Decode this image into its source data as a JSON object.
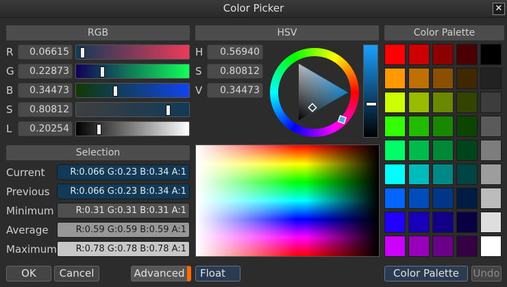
{
  "window": {
    "title": "Color Picker",
    "close_glyph": "✕"
  },
  "rgb": {
    "header": "RGB",
    "rows": [
      {
        "label": "R",
        "value": "0.06615",
        "fraction": 0.06615
      },
      {
        "label": "G",
        "value": "0.22873",
        "fraction": 0.22873
      },
      {
        "label": "B",
        "value": "0.34473",
        "fraction": 0.34473
      },
      {
        "label": "S",
        "value": "0.80812",
        "fraction": 0.80812
      },
      {
        "label": "L",
        "value": "0.20254",
        "fraction": 0.20254
      }
    ]
  },
  "hsv": {
    "header": "HSV",
    "rows": [
      {
        "label": "H",
        "value": "0.56940"
      },
      {
        "label": "S",
        "value": "0.80812"
      },
      {
        "label": "V",
        "value": "0.34473"
      }
    ]
  },
  "selection": {
    "header": "Selection",
    "rows": [
      {
        "label": "Current",
        "value": "R:0.066 G:0.23 B:0.34 A:1",
        "color": "#113a58",
        "text_color": "#e6e6e6"
      },
      {
        "label": "Previous",
        "value": "R:0.066 G:0.23 B:0.34 A:1",
        "color": "#113a58",
        "text_color": "#e6e6e6"
      },
      {
        "label": "Minimum",
        "value": "R:0.31 G:0.31 B:0.31 A:1",
        "color": "#4f4f4f",
        "text_color": "#e6e6e6"
      },
      {
        "label": "Average",
        "value": "R:0.59 G:0.59 B:0.59 A:1",
        "color": "#979797",
        "text_color": "#1a1a1a"
      },
      {
        "label": "Maximum",
        "value": "R:0.78 G:0.78 B:0.78 A:1",
        "color": "#c7c7c7",
        "text_color": "#1a1a1a"
      }
    ]
  },
  "palette": {
    "header": "Color Palette",
    "rows": [
      [
        "#ff0000",
        "#cc0000",
        "#8c0000",
        "#4a0000",
        "#000000"
      ],
      [
        "#ff9900",
        "#c07000",
        "#8a5000",
        "#3f2800",
        "#222222"
      ],
      [
        "#ccff00",
        "#99bb00",
        "#6a8800",
        "#334400",
        "#3d3d3d"
      ],
      [
        "#33ff00",
        "#22bb00",
        "#178800",
        "#0c4400",
        "#5a5a5a"
      ],
      [
        "#00ff66",
        "#00bb4c",
        "#008836",
        "#00441b",
        "#7d7d7d"
      ],
      [
        "#00ffff",
        "#00bbbb",
        "#008888",
        "#004444",
        "#9d9d9d"
      ],
      [
        "#0066ff",
        "#004cbb",
        "#003688",
        "#001b44",
        "#bcbcbc"
      ],
      [
        "#2200ff",
        "#1800bb",
        "#110088",
        "#090044",
        "#dedede"
      ],
      [
        "#cc00ff",
        "#9900bb",
        "#6a0088",
        "#350044",
        "#ffffff"
      ]
    ]
  },
  "colors": {
    "current": "#113a58",
    "accent": "#ff6a00"
  },
  "buttons": {
    "ok": "OK",
    "cancel": "Cancel",
    "advanced": "Advanced",
    "float": "Float",
    "color_palette": "Color Palette",
    "undo": "Undo"
  }
}
